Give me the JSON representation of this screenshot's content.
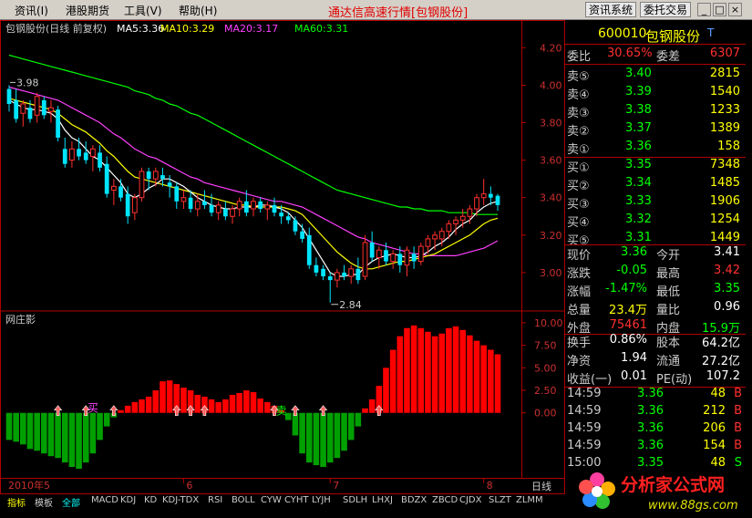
{
  "menu": {
    "items": [
      "资讯(I)",
      "港股期货",
      "工具(V)",
      "帮助(H)"
    ],
    "title": "通达信高速行情[包钢股份]",
    "btn_info": "资讯系统",
    "btn_trade": "委托交易",
    "win_min": "_",
    "win_max": "□",
    "win_close": "×"
  },
  "main_chart": {
    "header": "包钢股份(日线 前复权)",
    "ma": [
      {
        "label": "MA5:3.36",
        "color": "#ffffff"
      },
      {
        "label": "MA10:3.29",
        "color": "#ffff00"
      },
      {
        "label": "MA20:3.17",
        "color": "#ff40ff"
      },
      {
        "label": "MA60:3.31",
        "color": "#00ff00"
      }
    ],
    "y_ticks": [
      "4.20",
      "4.00",
      "3.80",
      "3.60",
      "3.40",
      "3.20",
      "3.00"
    ],
    "annot_high": "3.98",
    "annot_low": "2.84",
    "chart_data": {
      "type": "candlestick",
      "ylim": [
        2.8,
        4.26
      ],
      "candles": [
        {
          "o": 3.98,
          "h": 4.0,
          "l": 3.86,
          "c": 3.9
        },
        {
          "o": 3.92,
          "h": 3.98,
          "l": 3.8,
          "c": 3.82
        },
        {
          "o": 3.85,
          "h": 3.92,
          "l": 3.78,
          "c": 3.9
        },
        {
          "o": 3.88,
          "h": 3.92,
          "l": 3.8,
          "c": 3.82
        },
        {
          "o": 3.84,
          "h": 3.96,
          "l": 3.8,
          "c": 3.94
        },
        {
          "o": 3.92,
          "h": 3.94,
          "l": 3.82,
          "c": 3.84
        },
        {
          "o": 3.86,
          "h": 3.92,
          "l": 3.8,
          "c": 3.88
        },
        {
          "o": 3.87,
          "h": 3.89,
          "l": 3.7,
          "c": 3.72
        },
        {
          "o": 3.66,
          "h": 3.72,
          "l": 3.56,
          "c": 3.58
        },
        {
          "o": 3.6,
          "h": 3.7,
          "l": 3.56,
          "c": 3.66
        },
        {
          "o": 3.66,
          "h": 3.72,
          "l": 3.6,
          "c": 3.62
        },
        {
          "o": 3.64,
          "h": 3.7,
          "l": 3.58,
          "c": 3.6
        },
        {
          "o": 3.62,
          "h": 3.68,
          "l": 3.54,
          "c": 3.66
        },
        {
          "o": 3.64,
          "h": 3.68,
          "l": 3.54,
          "c": 3.56
        },
        {
          "o": 3.58,
          "h": 3.62,
          "l": 3.4,
          "c": 3.42
        },
        {
          "o": 3.44,
          "h": 3.5,
          "l": 3.36,
          "c": 3.46
        },
        {
          "o": 3.46,
          "h": 3.5,
          "l": 3.38,
          "c": 3.4
        },
        {
          "o": 3.42,
          "h": 3.46,
          "l": 3.26,
          "c": 3.3
        },
        {
          "o": 3.32,
          "h": 3.42,
          "l": 3.28,
          "c": 3.4
        },
        {
          "o": 3.4,
          "h": 3.56,
          "l": 3.38,
          "c": 3.54
        },
        {
          "o": 3.54,
          "h": 3.56,
          "l": 3.44,
          "c": 3.5
        },
        {
          "o": 3.5,
          "h": 3.56,
          "l": 3.46,
          "c": 3.54
        },
        {
          "o": 3.52,
          "h": 3.56,
          "l": 3.46,
          "c": 3.5
        },
        {
          "o": 3.48,
          "h": 3.52,
          "l": 3.4,
          "c": 3.46
        },
        {
          "o": 3.46,
          "h": 3.48,
          "l": 3.34,
          "c": 3.38
        },
        {
          "o": 3.38,
          "h": 3.44,
          "l": 3.34,
          "c": 3.4
        },
        {
          "o": 3.4,
          "h": 3.44,
          "l": 3.32,
          "c": 3.34
        },
        {
          "o": 3.34,
          "h": 3.42,
          "l": 3.3,
          "c": 3.38
        },
        {
          "o": 3.38,
          "h": 3.44,
          "l": 3.34,
          "c": 3.36
        },
        {
          "o": 3.36,
          "h": 3.42,
          "l": 3.3,
          "c": 3.32
        },
        {
          "o": 3.32,
          "h": 3.38,
          "l": 3.28,
          "c": 3.36
        },
        {
          "o": 3.34,
          "h": 3.38,
          "l": 3.28,
          "c": 3.3
        },
        {
          "o": 3.3,
          "h": 3.36,
          "l": 3.26,
          "c": 3.34
        },
        {
          "o": 3.34,
          "h": 3.4,
          "l": 3.3,
          "c": 3.38
        },
        {
          "o": 3.38,
          "h": 3.44,
          "l": 3.3,
          "c": 3.32
        },
        {
          "o": 3.34,
          "h": 3.4,
          "l": 3.3,
          "c": 3.38
        },
        {
          "o": 3.38,
          "h": 3.4,
          "l": 3.32,
          "c": 3.34
        },
        {
          "o": 3.34,
          "h": 3.38,
          "l": 3.28,
          "c": 3.36
        },
        {
          "o": 3.36,
          "h": 3.4,
          "l": 3.3,
          "c": 3.32
        },
        {
          "o": 3.32,
          "h": 3.36,
          "l": 3.26,
          "c": 3.3
        },
        {
          "o": 3.3,
          "h": 3.32,
          "l": 3.26,
          "c": 3.28
        },
        {
          "o": 3.28,
          "h": 3.3,
          "l": 3.2,
          "c": 3.22
        },
        {
          "o": 3.22,
          "h": 3.26,
          "l": 3.16,
          "c": 3.18
        },
        {
          "o": 3.2,
          "h": 3.24,
          "l": 3.02,
          "c": 3.04
        },
        {
          "o": 3.04,
          "h": 3.08,
          "l": 2.98,
          "c": 3.0
        },
        {
          "o": 3.02,
          "h": 3.04,
          "l": 2.96,
          "c": 2.98
        },
        {
          "o": 2.98,
          "h": 3.0,
          "l": 2.84,
          "c": 2.96
        },
        {
          "o": 2.96,
          "h": 3.02,
          "l": 2.92,
          "c": 3.0
        },
        {
          "o": 3.0,
          "h": 3.04,
          "l": 2.96,
          "c": 2.98
        },
        {
          "o": 2.98,
          "h": 3.04,
          "l": 2.94,
          "c": 3.02
        },
        {
          "o": 3.02,
          "h": 3.08,
          "l": 2.94,
          "c": 2.96
        },
        {
          "o": 2.98,
          "h": 3.2,
          "l": 2.96,
          "c": 3.16
        },
        {
          "o": 3.16,
          "h": 3.22,
          "l": 3.06,
          "c": 3.08
        },
        {
          "o": 3.08,
          "h": 3.14,
          "l": 3.02,
          "c": 3.12
        },
        {
          "o": 3.12,
          "h": 3.16,
          "l": 3.04,
          "c": 3.06
        },
        {
          "o": 3.06,
          "h": 3.12,
          "l": 3.02,
          "c": 3.1
        },
        {
          "o": 3.1,
          "h": 3.14,
          "l": 3.0,
          "c": 3.04
        },
        {
          "o": 3.04,
          "h": 3.14,
          "l": 2.98,
          "c": 3.12
        },
        {
          "o": 3.1,
          "h": 3.14,
          "l": 3.02,
          "c": 3.06
        },
        {
          "o": 3.06,
          "h": 3.16,
          "l": 3.04,
          "c": 3.14
        },
        {
          "o": 3.14,
          "h": 3.2,
          "l": 3.1,
          "c": 3.18
        },
        {
          "o": 3.18,
          "h": 3.22,
          "l": 3.12,
          "c": 3.2
        },
        {
          "o": 3.18,
          "h": 3.24,
          "l": 3.14,
          "c": 3.22
        },
        {
          "o": 3.22,
          "h": 3.28,
          "l": 3.18,
          "c": 3.26
        },
        {
          "o": 3.26,
          "h": 3.3,
          "l": 3.2,
          "c": 3.28
        },
        {
          "o": 3.28,
          "h": 3.34,
          "l": 3.24,
          "c": 3.3
        },
        {
          "o": 3.3,
          "h": 3.36,
          "l": 3.26,
          "c": 3.34
        },
        {
          "o": 3.34,
          "h": 3.42,
          "l": 3.3,
          "c": 3.4
        },
        {
          "o": 3.4,
          "h": 3.5,
          "l": 3.36,
          "c": 3.42
        },
        {
          "o": 3.42,
          "h": 3.46,
          "l": 3.36,
          "c": 3.4
        },
        {
          "o": 3.41,
          "h": 3.42,
          "l": 3.33,
          "c": 3.36
        }
      ],
      "ma5": [
        3.92,
        3.9,
        3.88,
        3.87,
        3.87,
        3.86,
        3.85,
        3.82,
        3.76,
        3.72,
        3.7,
        3.66,
        3.62,
        3.6,
        3.56,
        3.52,
        3.48,
        3.42,
        3.4,
        3.42,
        3.45,
        3.47,
        3.5,
        3.5,
        3.48,
        3.46,
        3.43,
        3.4,
        3.38,
        3.36,
        3.35,
        3.34,
        3.34,
        3.35,
        3.35,
        3.35,
        3.36,
        3.36,
        3.35,
        3.34,
        3.32,
        3.28,
        3.24,
        3.18,
        3.12,
        3.06,
        3.0,
        2.98,
        2.98,
        2.99,
        2.99,
        3.03,
        3.06,
        3.08,
        3.09,
        3.1,
        3.09,
        3.08,
        3.08,
        3.09,
        3.11,
        3.14,
        3.16,
        3.19,
        3.23,
        3.26,
        3.28,
        3.32,
        3.35,
        3.37,
        3.38
      ],
      "ma10": [
        3.93,
        3.92,
        3.91,
        3.9,
        3.89,
        3.88,
        3.87,
        3.85,
        3.82,
        3.79,
        3.77,
        3.75,
        3.72,
        3.69,
        3.65,
        3.62,
        3.58,
        3.54,
        3.51,
        3.5,
        3.49,
        3.48,
        3.47,
        3.46,
        3.45,
        3.44,
        3.43,
        3.42,
        3.41,
        3.4,
        3.39,
        3.38,
        3.37,
        3.36,
        3.36,
        3.35,
        3.35,
        3.35,
        3.35,
        3.35,
        3.34,
        3.33,
        3.31,
        3.27,
        3.23,
        3.19,
        3.15,
        3.11,
        3.08,
        3.05,
        3.03,
        3.02,
        3.02,
        3.03,
        3.04,
        3.05,
        3.06,
        3.06,
        3.07,
        3.08,
        3.09,
        3.1,
        3.12,
        3.14,
        3.16,
        3.18,
        3.2,
        3.23,
        3.26,
        3.28,
        3.29
      ],
      "ma20": [
        3.99,
        3.98,
        3.97,
        3.96,
        3.95,
        3.94,
        3.93,
        3.92,
        3.9,
        3.88,
        3.86,
        3.84,
        3.82,
        3.8,
        3.77,
        3.74,
        3.72,
        3.69,
        3.66,
        3.64,
        3.62,
        3.61,
        3.59,
        3.57,
        3.55,
        3.53,
        3.51,
        3.5,
        3.48,
        3.47,
        3.46,
        3.45,
        3.44,
        3.43,
        3.42,
        3.41,
        3.4,
        3.39,
        3.38,
        3.38,
        3.37,
        3.36,
        3.35,
        3.33,
        3.31,
        3.29,
        3.27,
        3.25,
        3.23,
        3.21,
        3.19,
        3.18,
        3.16,
        3.15,
        3.14,
        3.13,
        3.12,
        3.11,
        3.1,
        3.1,
        3.09,
        3.09,
        3.09,
        3.09,
        3.09,
        3.1,
        3.11,
        3.12,
        3.13,
        3.15,
        3.17
      ],
      "ma60": [
        4.16,
        4.15,
        4.14,
        4.13,
        4.12,
        4.11,
        4.1,
        4.09,
        4.08,
        4.07,
        4.06,
        4.05,
        4.04,
        4.03,
        4.02,
        4.01,
        4.0,
        3.99,
        3.97,
        3.96,
        3.95,
        3.93,
        3.92,
        3.9,
        3.89,
        3.87,
        3.85,
        3.84,
        3.82,
        3.8,
        3.78,
        3.76,
        3.74,
        3.72,
        3.7,
        3.68,
        3.66,
        3.64,
        3.62,
        3.6,
        3.58,
        3.56,
        3.54,
        3.52,
        3.5,
        3.48,
        3.46,
        3.44,
        3.43,
        3.42,
        3.41,
        3.4,
        3.39,
        3.38,
        3.37,
        3.36,
        3.35,
        3.35,
        3.34,
        3.34,
        3.33,
        3.33,
        3.33,
        3.32,
        3.32,
        3.32,
        3.32,
        3.31,
        3.31,
        3.31,
        3.31
      ]
    }
  },
  "indicator": {
    "title": "网庄影",
    "y_ticks": [
      "10.00",
      "7.50",
      "5.00",
      "2.50",
      "0.00"
    ],
    "buy_label": "买",
    "sell_label": "卖",
    "chart_data": {
      "type": "bar",
      "ylim": [
        -6.5,
        11
      ],
      "values": [
        -3,
        -3.2,
        -3.5,
        -4,
        -4.2,
        -4.5,
        -4.8,
        -5,
        -5.5,
        -6,
        -6.2,
        -5.5,
        -4.5,
        -3,
        -1.5,
        -0.5,
        0.3,
        0.8,
        1.2,
        1.5,
        1.8,
        2.5,
        3.5,
        3.6,
        3.2,
        2.8,
        2.5,
        2,
        1.8,
        1.5,
        1.2,
        1.5,
        2,
        2.2,
        2.5,
        2.3,
        1.6,
        1.2,
        0.8,
        0.3,
        -0.8,
        -2.5,
        -4.5,
        -5.5,
        -5.8,
        -6,
        -5.5,
        -5,
        -4.2,
        -3,
        -1.5,
        0.5,
        1.5,
        3,
        5,
        7,
        8.5,
        9.4,
        9.7,
        9.4,
        9,
        8.5,
        8.8,
        9.4,
        9.6,
        9.2,
        8.6,
        8,
        7.5,
        7,
        6.5
      ],
      "buy_arrows": [
        7,
        11,
        15,
        24,
        26,
        28,
        38,
        41,
        45,
        53
      ],
      "buy_marker_index": 12,
      "sell_marker_index": 39
    }
  },
  "date_axis": {
    "labels": [
      {
        "text": "2010年5",
        "i": 0
      },
      {
        "text": "6",
        "i": 25
      },
      {
        "text": "7",
        "i": 46
      },
      {
        "text": "8",
        "i": 68
      }
    ],
    "period": "日线"
  },
  "tabs": [
    "指标",
    "模板",
    "全部",
    "MACD",
    "KDJ",
    "KD",
    "KDJ-TDX",
    "RSI",
    "BOLL",
    "CYW",
    "CYHT",
    "LYJH",
    "SDLH",
    "LHXJ",
    "BDZX",
    "ZBCD",
    "CJDX",
    "SLZT",
    "ZLMM"
  ],
  "panel": {
    "code": "600010",
    "name": "包钢股份",
    "name_mark": "T",
    "weibi_label": "委比",
    "weibi": "30.65%",
    "weicha_label": "委差",
    "weicha": "6307",
    "sell": [
      {
        "label": "卖⑤",
        "price": "3.40",
        "vol": "2815"
      },
      {
        "label": "卖④",
        "price": "3.39",
        "vol": "1540"
      },
      {
        "label": "卖③",
        "price": "3.38",
        "vol": "1233"
      },
      {
        "label": "卖②",
        "price": "3.37",
        "vol": "1389"
      },
      {
        "label": "卖①",
        "price": "3.36",
        "vol": "158"
      }
    ],
    "buy": [
      {
        "label": "买①",
        "price": "3.35",
        "vol": "7348"
      },
      {
        "label": "买②",
        "price": "3.34",
        "vol": "1485"
      },
      {
        "label": "买③",
        "price": "3.33",
        "vol": "1906"
      },
      {
        "label": "买④",
        "price": "3.32",
        "vol": "1254"
      },
      {
        "label": "买⑤",
        "price": "3.31",
        "vol": "1449"
      }
    ],
    "stats": [
      {
        "l1": "现价",
        "v1": "3.36",
        "c1": "#00ff00",
        "l2": "今开",
        "v2": "3.41",
        "c2": "#ffffff"
      },
      {
        "l1": "涨跌",
        "v1": "-0.05",
        "c1": "#00ff00",
        "l2": "最高",
        "v2": "3.42",
        "c2": "#ff3030"
      },
      {
        "l1": "涨幅",
        "v1": "-1.47%",
        "c1": "#00ff00",
        "l2": "最低",
        "v2": "3.35",
        "c2": "#00ff00"
      },
      {
        "l1": "总量",
        "v1": "23.4万",
        "c1": "#ffff00",
        "l2": "量比",
        "v2": "0.96",
        "c2": "#ffffff"
      },
      {
        "l1": "外盘",
        "v1": "75461",
        "c1": "#ff3030",
        "l2": "内盘",
        "v2": "15.9万",
        "c2": "#00ff00"
      }
    ],
    "fin": [
      {
        "l1": "换手",
        "v1": "0.86%",
        "l2": "股本",
        "v2": "64.2亿"
      },
      {
        "l1": "净资",
        "v1": "1.94",
        "l2": "流通",
        "v2": "27.2亿"
      },
      {
        "l1": "收益(一)",
        "v1": "0.01",
        "l2": "PE(动)",
        "v2": "107.2"
      }
    ],
    "ticks": [
      {
        "time": "14:59",
        "price": "3.36",
        "vol": "48",
        "side": "B"
      },
      {
        "time": "14:59",
        "price": "3.36",
        "vol": "212",
        "side": "B"
      },
      {
        "time": "14:59",
        "price": "3.36",
        "vol": "206",
        "side": "B"
      },
      {
        "time": "14:59",
        "price": "3.36",
        "vol": "154",
        "side": "B"
      },
      {
        "time": "15:00",
        "price": "3.35",
        "vol": "48",
        "side": "S"
      }
    ]
  },
  "watermark": {
    "title": "分析家公式网",
    "url": "www.88gs.com"
  },
  "colors": {
    "up": "#ff3030",
    "down": "#00e5ff",
    "ma5": "#ffffff",
    "ma10": "#ffff00",
    "ma20": "#ff40ff",
    "ma60": "#00ff00",
    "frame": "#b00000",
    "ind_pos": "#ff0000",
    "ind_neg": "#00a000"
  }
}
